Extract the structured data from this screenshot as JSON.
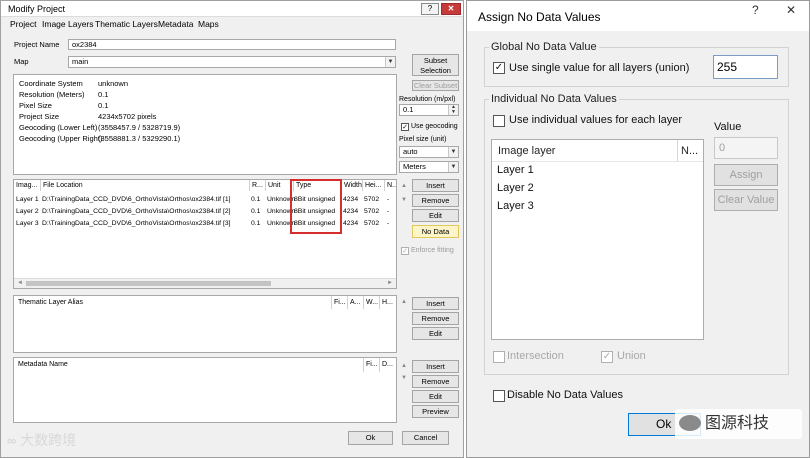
{
  "modify_project": {
    "title": "Modify Project",
    "title_buttons": {
      "help": "?",
      "minimize": "–",
      "close": "✕"
    },
    "menu": [
      "Project",
      "Image Layers",
      "Thematic Layers",
      "Metadata",
      "Maps"
    ],
    "project_name_label": "Project Name",
    "project_name_value": "ox2384",
    "map_label": "Map",
    "map_value": "main",
    "info_rows": [
      {
        "label": "Coordinate System",
        "value": "unknown"
      },
      {
        "label": "Resolution (Meters)",
        "value": "0.1"
      },
      {
        "label": "Pixel Size",
        "value": "0.1"
      },
      {
        "label": "Project Size",
        "value": "4234x5702 pixels"
      },
      {
        "label": "Geocoding (Lower Left)",
        "value": "(3558457.9 / 5328719.9)"
      },
      {
        "label": "Geocoding (Upper Right)",
        "value": "(3558881.3 / 5329290.1)"
      }
    ],
    "subset_selection": "Subset Selection",
    "clear_subset": "Clear Subset",
    "resolution_label": "Resolution (m/pxl)",
    "resolution_value": "0.1",
    "use_geocoding": "Use geocoding",
    "pixel_size_label": "Pixel size (unit)",
    "pixel_size_value": "auto",
    "unit_value": "Meters",
    "image_layers": {
      "headers": [
        "Imag...",
        "File Location",
        "R...",
        "Unit",
        "Type",
        "Width",
        "Hei...",
        "N..."
      ],
      "rows": [
        [
          "Layer 1",
          "D:\\TrainingData_CCD_DVD\\6_OrthoVista\\Orthos\\ox2384.tif [1]",
          "0.1",
          "Unknown",
          "8Bit unsigned",
          "4234",
          "5702",
          "-"
        ],
        [
          "Layer 2",
          "D:\\TrainingData_CCD_DVD\\6_OrthoVista\\Orthos\\ox2384.tif [2]",
          "0.1",
          "Unknown",
          "8Bit unsigned",
          "4234",
          "5702",
          "-"
        ],
        [
          "Layer 3",
          "D:\\TrainingData_CCD_DVD\\6_OrthoVista\\Orthos\\ox2384.tif [3]",
          "0.1",
          "Unknown",
          "8Bit unsigned",
          "4234",
          "5702",
          "-"
        ]
      ],
      "buttons": [
        "Insert",
        "Remove",
        "Edit",
        "No Data"
      ],
      "enforce_fitting": "Enforce fitting",
      "highlight_color": "#d62d2d"
    },
    "thematic": {
      "headers": [
        "Thematic Layer Alias",
        "Fi...",
        "A...",
        "W...",
        "H..."
      ],
      "buttons": [
        "Insert",
        "Remove",
        "Edit"
      ]
    },
    "metadata": {
      "headers": [
        "Metadata Name",
        "Fi...",
        "D..."
      ],
      "buttons": [
        "Insert",
        "Remove",
        "Edit",
        "Preview"
      ]
    },
    "ok": "Ok",
    "cancel": "Cancel",
    "watermark": "大数跨境"
  },
  "assign_no_data": {
    "title": "Assign No Data Values",
    "help": "?",
    "close": "✕",
    "global_group": "Global No Data Value",
    "use_single": "Use single value for all layers (union)",
    "use_single_checked": true,
    "global_value": "255",
    "individual_group": "Individual No Data Values",
    "use_individual": "Use individual values for each layer",
    "use_individual_checked": false,
    "list_headers": [
      "Image layer",
      "N..."
    ],
    "layers": [
      "Layer 1",
      "Layer 2",
      "Layer 3"
    ],
    "value_label": "Value",
    "value_input": "0",
    "assign": "Assign",
    "clear_value": "Clear Value",
    "intersection": "Intersection",
    "union": "Union",
    "union_checked": true,
    "disable": "Disable No Data Values",
    "disable_checked": false,
    "ok": "Ok",
    "watermark": "图源科技"
  }
}
